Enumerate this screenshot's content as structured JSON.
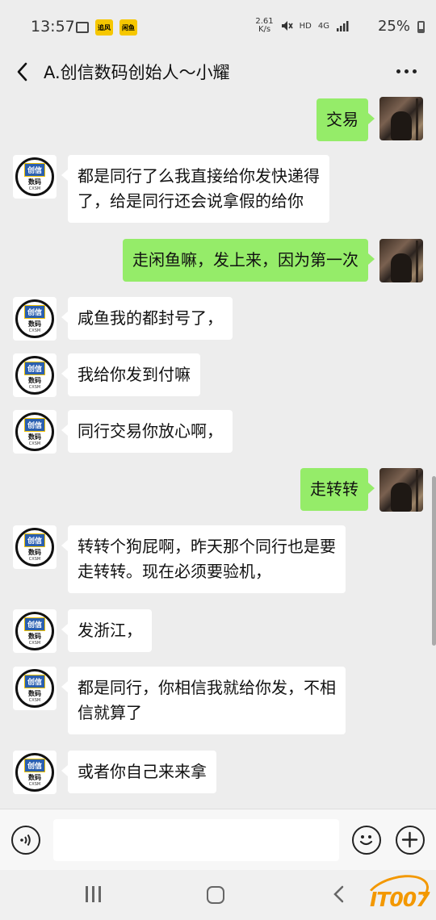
{
  "status_bar": {
    "time": "13:57",
    "app_icon_1": "追风",
    "app_icon_2": "闲鱼",
    "net_speed_value": "2.61",
    "net_speed_unit": "K/s",
    "hd": "HD",
    "network": "4G",
    "battery": "25%"
  },
  "header": {
    "title": "A.创信数码创始人～小耀"
  },
  "logo": {
    "top": "创信",
    "bottom": "数码",
    "tiny": "CXSM"
  },
  "messages": [
    {
      "side": "out",
      "text": "交易"
    },
    {
      "side": "in",
      "line1": "都是同行了么我直接给你发快递得",
      "line2": "了，给是同行还会说拿假的给你"
    },
    {
      "side": "out",
      "text": "走闲鱼嘛，发上来，因为第一次"
    },
    {
      "side": "in",
      "text": "咸鱼我的都封号了，"
    },
    {
      "side": "in",
      "text": "我给你发到付嘛"
    },
    {
      "side": "in",
      "text": "同行交易你放心啊，"
    },
    {
      "side": "out",
      "text": "走转转"
    },
    {
      "side": "in",
      "line1": "转转个狗屁啊，昨天那个同行也是要",
      "line2": "走转转。现在必须要验机，"
    },
    {
      "side": "in",
      "text": "发浙江，"
    },
    {
      "side": "in",
      "line1": "都是同行，你相信我就给你发，不相",
      "line2": "信就算了"
    },
    {
      "side": "in",
      "text": "或者你自己来来拿"
    }
  ],
  "input": {
    "placeholder": ""
  },
  "watermark": {
    "text": "IT007"
  },
  "colors": {
    "outgoing_bubble": "#95ec69",
    "incoming_bubble": "#ffffff",
    "background": "#ededed",
    "watermark": "#f39800"
  }
}
